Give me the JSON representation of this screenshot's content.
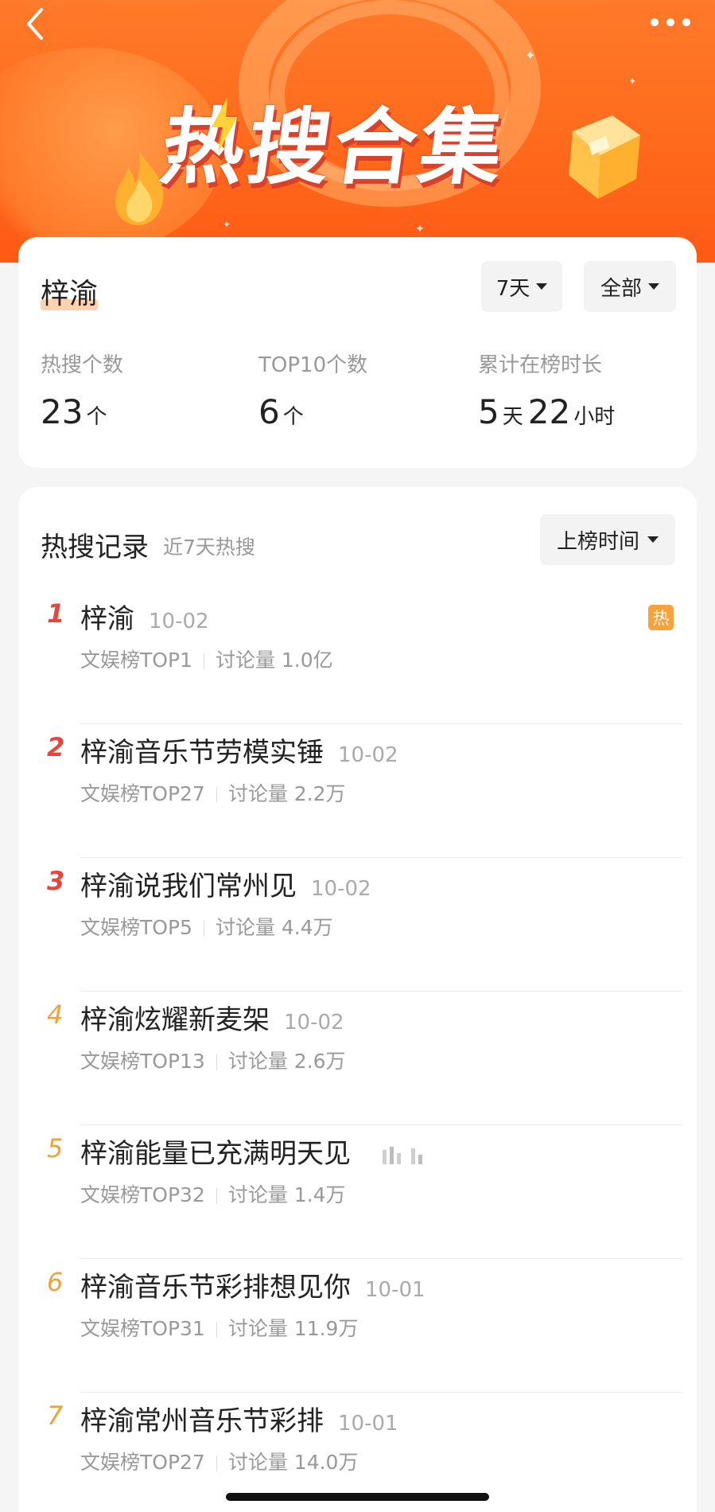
{
  "banner": {
    "title": "热搜合集"
  },
  "summary": {
    "topic": "梓渝",
    "filter_days": "7天",
    "filter_scope": "全部",
    "stats": {
      "hot_count": {
        "label": "热搜个数",
        "value": "23",
        "unit": "个"
      },
      "top10_count": {
        "label": "TOP10个数",
        "value": "6",
        "unit": "个"
      },
      "duration": {
        "label": "累计在榜时长",
        "days": "5",
        "days_unit": "天",
        "hours": "22",
        "hours_unit": "小时"
      }
    }
  },
  "records": {
    "title": "热搜记录",
    "subtitle": "近7天热搜",
    "sort_label": "上榜时间",
    "hot_badge": "热",
    "items": [
      {
        "rank": "1",
        "title": "梓渝",
        "date": "10-02",
        "board": "文娱榜TOP1",
        "discussion": "讨论量 1.0亿"
      },
      {
        "rank": "2",
        "title": "梓渝音乐节劳模实锤",
        "date": "10-02",
        "board": "文娱榜TOP27",
        "discussion": "讨论量 2.2万"
      },
      {
        "rank": "3",
        "title": "梓渝说我们常州见",
        "date": "10-02",
        "board": "文娱榜TOP5",
        "discussion": "讨论量 4.4万"
      },
      {
        "rank": "4",
        "title": "梓渝炫耀新麦架",
        "date": "10-02",
        "board": "文娱榜TOP13",
        "discussion": "讨论量 2.6万"
      },
      {
        "rank": "5",
        "title": "梓渝能量已充满明天见",
        "date": "",
        "board": "文娱榜TOP32",
        "discussion": "讨论量 1.4万"
      },
      {
        "rank": "6",
        "title": "梓渝音乐节彩排想见你",
        "date": "10-01",
        "board": "文娱榜TOP31",
        "discussion": "讨论量 11.9万"
      },
      {
        "rank": "7",
        "title": "梓渝常州音乐节彩排",
        "date": "10-01",
        "board": "文娱榜TOP27",
        "discussion": "讨论量 14.0万"
      }
    ]
  },
  "colors": {
    "banner_orange": "#ff6a1c",
    "rank_top3": "#e8453c",
    "rank_other": "#f0a23a",
    "hot_badge": "#f7a23a"
  },
  "icons": [
    "back-arrow-icon",
    "more-dots-icon",
    "caret-down-icon",
    "hot-badge-icon",
    "live-bars-icon"
  ]
}
